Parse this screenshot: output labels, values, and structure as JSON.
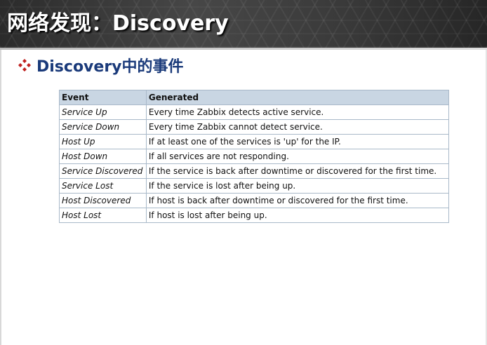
{
  "slide": {
    "title": "网络发现：Discovery",
    "subtitle": "Discovery中的事件",
    "bullet_icon": "diamond-bullet-icon",
    "colors": {
      "header_bg": "#3a3a3a",
      "title_text": "#ffffff",
      "subtitle_text": "#1a3a7a",
      "bullet": "#c0201f",
      "table_header_bg": "#c9d6e3",
      "table_border": "#a9b9c9"
    }
  },
  "table": {
    "headers": [
      "Event",
      "Generated"
    ],
    "rows": [
      {
        "event": "Service Up",
        "generated": "Every time Zabbix detects active service."
      },
      {
        "event": "Service Down",
        "generated": "Every time Zabbix cannot detect service."
      },
      {
        "event": "Host Up",
        "generated": "If at least one of the services is 'up' for the IP."
      },
      {
        "event": "Host Down",
        "generated": "If all services are not responding."
      },
      {
        "event": "Service Discovered",
        "generated": "If the service is back after downtime or discovered for the first time."
      },
      {
        "event": "Service Lost",
        "generated": "If the service is lost after being up."
      },
      {
        "event": "Host Discovered",
        "generated": "If host is back after downtime or discovered for the first time."
      },
      {
        "event": "Host Lost",
        "generated": "If host is lost after being up."
      }
    ]
  }
}
